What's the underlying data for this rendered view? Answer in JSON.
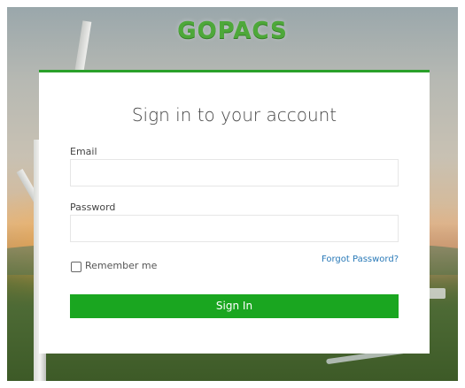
{
  "brand": {
    "logo_text": "GOPACS",
    "logo_color": "#4ea83a",
    "accent": "#2aa02a"
  },
  "login": {
    "title": "Sign in to your account",
    "email_label": "Email",
    "email_value": "",
    "email_placeholder": "",
    "password_label": "Password",
    "password_value": "",
    "password_placeholder": "",
    "remember_label": "Remember me",
    "remember_checked": false,
    "forgot_label": "Forgot Password?",
    "submit_label": "Sign In",
    "submit_color": "#1aa620",
    "link_color": "#2a7ab8"
  },
  "background": {
    "scene": "wind-turbine-landscape"
  }
}
